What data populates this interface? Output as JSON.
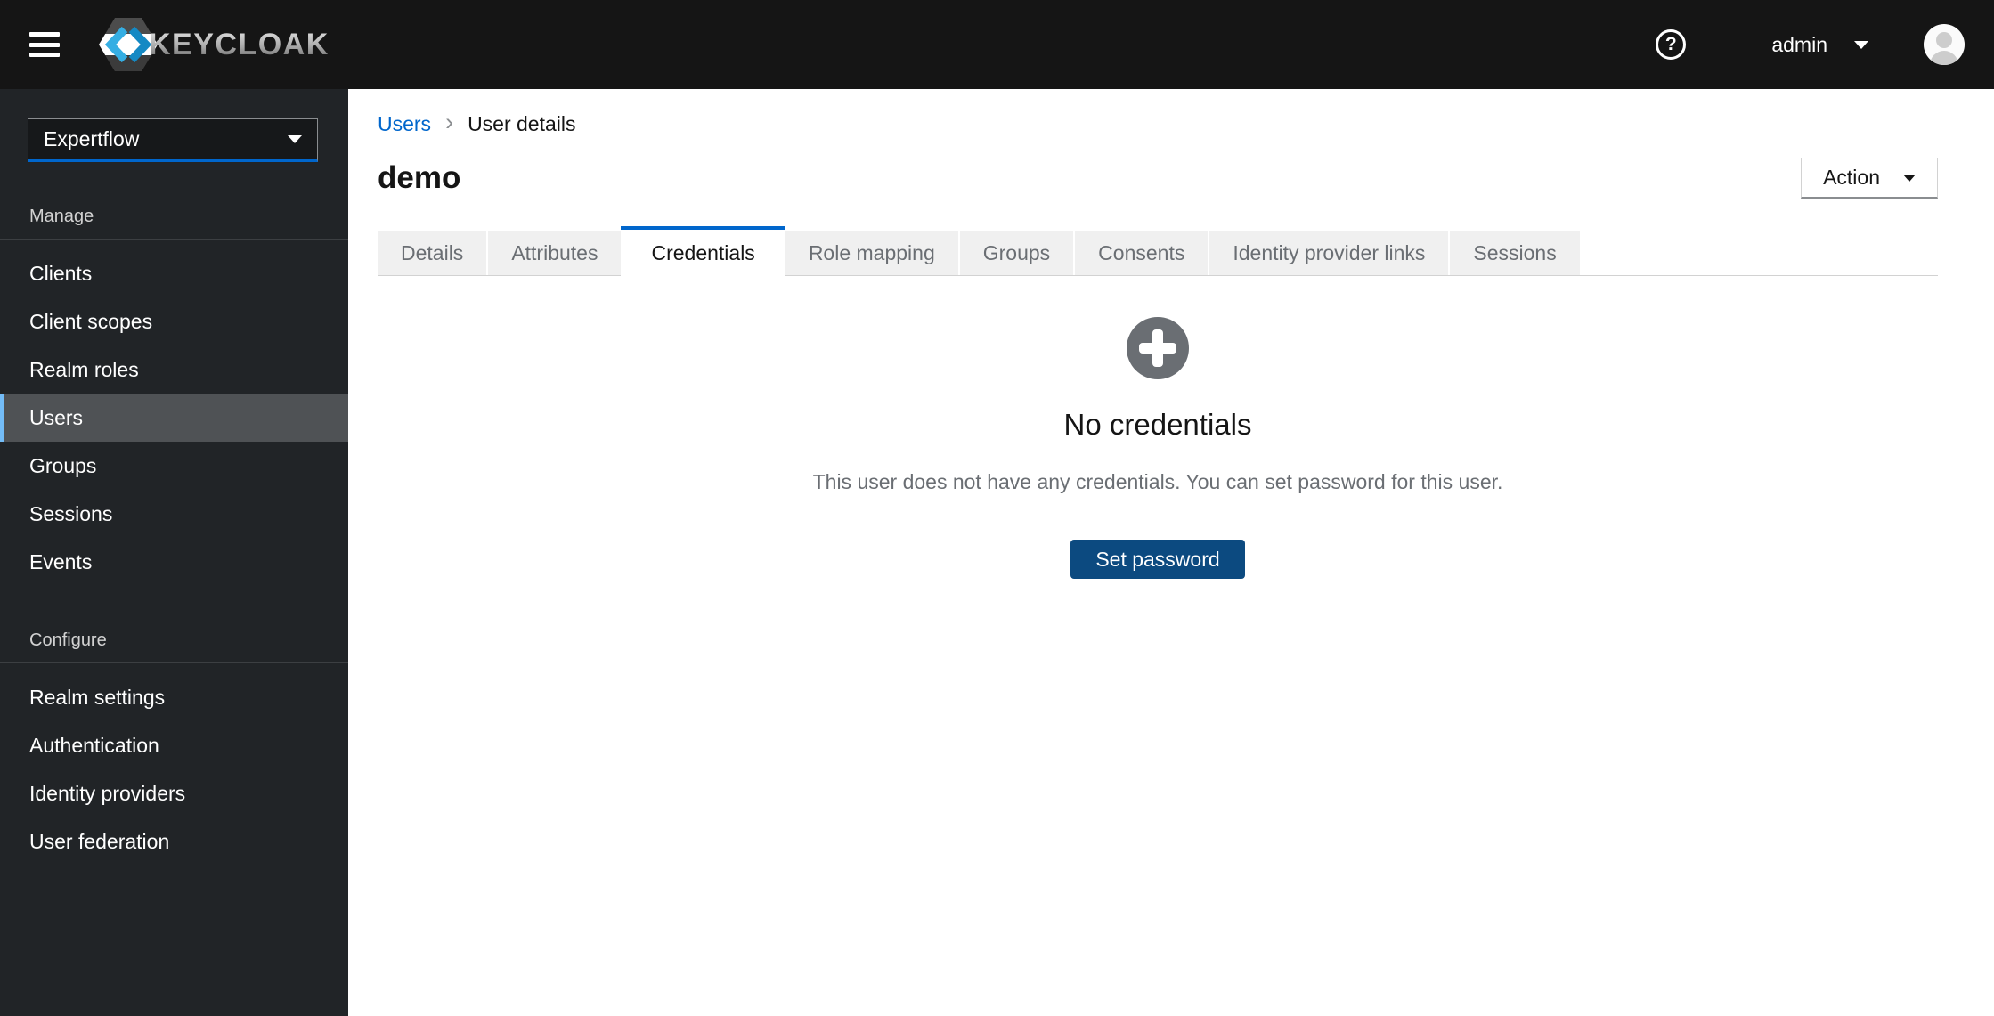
{
  "masthead": {
    "brand": "KEYCLOAK",
    "user_menu": {
      "label": "admin"
    },
    "help_icon_glyph": "?"
  },
  "sidebar": {
    "realm_selector": {
      "value": "Expertflow"
    },
    "groups": [
      {
        "label": "Manage",
        "items": [
          {
            "label": "Clients",
            "active": false
          },
          {
            "label": "Client scopes",
            "active": false
          },
          {
            "label": "Realm roles",
            "active": false
          },
          {
            "label": "Users",
            "active": true
          },
          {
            "label": "Groups",
            "active": false
          },
          {
            "label": "Sessions",
            "active": false
          },
          {
            "label": "Events",
            "active": false
          }
        ]
      },
      {
        "label": "Configure",
        "items": [
          {
            "label": "Realm settings",
            "active": false
          },
          {
            "label": "Authentication",
            "active": false
          },
          {
            "label": "Identity providers",
            "active": false
          },
          {
            "label": "User federation",
            "active": false
          }
        ]
      }
    ]
  },
  "main": {
    "breadcrumb": {
      "link": "Users",
      "separator": "›",
      "current": "User details"
    },
    "page_title": "demo",
    "action_dropdown_label": "Action",
    "tabs": [
      {
        "label": "Details",
        "active": false
      },
      {
        "label": "Attributes",
        "active": false
      },
      {
        "label": "Credentials",
        "active": true
      },
      {
        "label": "Role mapping",
        "active": false
      },
      {
        "label": "Groups",
        "active": false
      },
      {
        "label": "Consents",
        "active": false
      },
      {
        "label": "Identity provider links",
        "active": false
      },
      {
        "label": "Sessions",
        "active": false
      }
    ],
    "empty_state": {
      "icon": "plus-circle-icon",
      "title": "No credentials",
      "description": "This user does not have any credentials. You can set password for this user.",
      "primary_button": "Set password"
    }
  },
  "colors": {
    "masthead_bg": "#151515",
    "sidebar_bg": "#212427",
    "active_nav_bg": "#4f5255",
    "active_nav_border": "#73bcf7",
    "accent_blue": "#0066cc",
    "primary_button_bg": "#0c4a80",
    "muted_text": "#6a6e73",
    "tab_inactive_bg": "#f0f0f0"
  }
}
